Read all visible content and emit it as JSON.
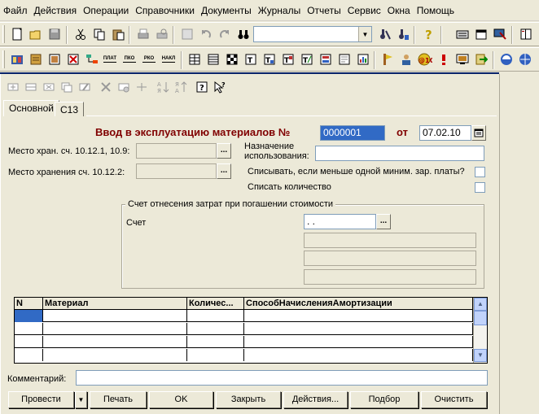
{
  "menu": [
    "Файл",
    "Действия",
    "Операции",
    "Справочники",
    "Документы",
    "Журналы",
    "Отчеты",
    "Сервис",
    "Окна",
    "Помощь"
  ],
  "toolbar2_labels": {
    "plat": "ПЛАТ",
    "pko": "ПКО",
    "rko": "РКО",
    "nakl": "НАКЛ"
  },
  "tabs": [
    "Основной",
    "С13"
  ],
  "form": {
    "title": "Ввод в эксплуатацию материалов №",
    "number": "0000001",
    "date_label": "от",
    "date": "07.02.10",
    "storage1_label": "Место хран. сч. 10.12.1, 10.9:",
    "storage1_value": "",
    "storage2_label": "Место хранения сч. 10.12.2:",
    "storage2_value": "",
    "purpose_label_1": "Назначение",
    "purpose_label_2": "использования:",
    "purpose_value": "",
    "writeoff_min_label": "Списывать, если меньше одной миним. зар. платы?",
    "writeoff_qty_label": "Списать количество",
    "group_title": "Счет отнесения затрат при погашении стоимости",
    "account_label": "Счет",
    "account_value": ". ."
  },
  "table": {
    "columns": [
      "N",
      "Материал",
      "Количес...",
      "СпособНачисленияАмортизации"
    ],
    "rows": 5
  },
  "comment_label": "Комментарий:",
  "comment_value": "",
  "buttons": {
    "post": "Провести",
    "print": "Печать",
    "ok": "OK",
    "close": "Закрыть",
    "actions": "Действия...",
    "select": "Подбор",
    "clear": "Очистить"
  },
  "dots": "...",
  "colors": {
    "title_red": "#800000",
    "selection": "#316ac5",
    "desktop": "#ece9d8"
  }
}
